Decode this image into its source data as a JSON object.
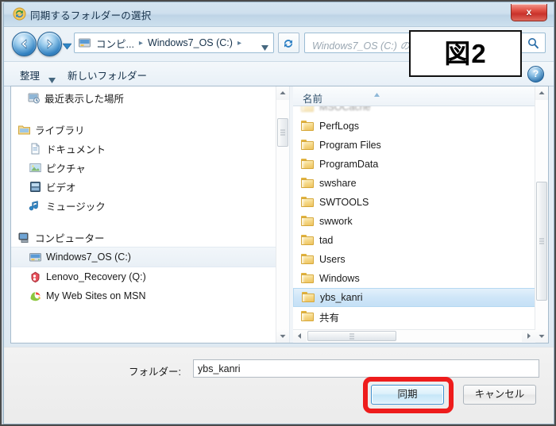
{
  "window": {
    "title": "同期するフォルダーの選択",
    "title_icon": "sync-arrows-icon",
    "close_label": "x"
  },
  "nav": {
    "back_icon": "arrow-left-icon",
    "forward_icon": "arrow-right-icon",
    "history_icon": "chevron-down-icon",
    "address_icon": "drive-icon",
    "address_dropdown_icon": "chevron-down-icon",
    "refresh_icon": "refresh-icon",
    "breadcrumbs": [
      {
        "label": "コンピ..."
      },
      {
        "label": "Windows7_OS (C:)"
      }
    ],
    "crumb_separator": "▸"
  },
  "search": {
    "placeholder": "Windows7_OS (C:) の検索",
    "visible_text": "Wind",
    "icon": "search-icon"
  },
  "command_bar": {
    "organize_label": "整理",
    "organize_caret_icon": "caret-down-icon",
    "new_folder_label": "新しいフォルダー",
    "help_label": "?",
    "help_icon": "help-icon"
  },
  "sidebar": {
    "items": [
      {
        "label": "最近表示した場所",
        "icon": "recent-places-icon",
        "indent": 20,
        "selected": false
      },
      {
        "label": "ライブラリ",
        "icon": "libraries-icon",
        "indent": 8,
        "selected": false
      },
      {
        "label": "ドキュメント",
        "icon": "documents-icon",
        "indent": 22,
        "selected": false
      },
      {
        "label": "ピクチャ",
        "icon": "pictures-icon",
        "indent": 22,
        "selected": false
      },
      {
        "label": "ビデオ",
        "icon": "videos-icon",
        "indent": 22,
        "selected": false
      },
      {
        "label": "ミュージック",
        "icon": "music-icon",
        "indent": 22,
        "selected": false
      },
      {
        "label": "コンピューター",
        "icon": "computer-icon",
        "indent": 8,
        "selected": false
      },
      {
        "label": "Windows7_OS (C:)",
        "icon": "drive-icon",
        "indent": 22,
        "selected": true
      },
      {
        "label": "Lenovo_Recovery (Q:)",
        "icon": "recovery-drive-icon",
        "indent": 22,
        "selected": false
      },
      {
        "label": "My Web Sites on MSN",
        "icon": "msn-icon",
        "indent": 22,
        "selected": false
      }
    ]
  },
  "file_list": {
    "column_header": "名前",
    "sort_icon": "sort-ascending-icon",
    "rows": [
      {
        "name": "MSOCache",
        "icon": "folder-icon",
        "selected": false,
        "clipped": true
      },
      {
        "name": "PerfLogs",
        "icon": "folder-icon",
        "selected": false,
        "clipped": false
      },
      {
        "name": "Program Files",
        "icon": "folder-icon",
        "selected": false,
        "clipped": false
      },
      {
        "name": "ProgramData",
        "icon": "folder-icon",
        "selected": false,
        "clipped": false
      },
      {
        "name": "swshare",
        "icon": "folder-icon",
        "selected": false,
        "clipped": false
      },
      {
        "name": "SWTOOLS",
        "icon": "folder-icon",
        "selected": false,
        "clipped": false
      },
      {
        "name": "swwork",
        "icon": "folder-icon",
        "selected": false,
        "clipped": false
      },
      {
        "name": "tad",
        "icon": "folder-icon",
        "selected": false,
        "clipped": false
      },
      {
        "name": "Users",
        "icon": "folder-icon",
        "selected": false,
        "clipped": false
      },
      {
        "name": "Windows",
        "icon": "folder-icon",
        "selected": false,
        "clipped": false
      },
      {
        "name": "ybs_kanri",
        "icon": "folder-icon",
        "selected": true,
        "clipped": false
      },
      {
        "name": "共有",
        "icon": "folder-icon",
        "selected": false,
        "clipped": false
      }
    ]
  },
  "scrollbars": {
    "up_icon": "scroll-up-icon",
    "down_icon": "scroll-down-icon",
    "left_icon": "scroll-left-icon",
    "right_icon": "scroll-right-icon"
  },
  "footer": {
    "folder_label": "フォルダー:",
    "folder_value": "ybs_kanri",
    "folder_placeholder": "",
    "sync_button": "同期",
    "cancel_button": "キャンセル"
  },
  "annotations": {
    "figure_label": "図2",
    "highlight_color": "#ee1c1c",
    "highlight_target": "sync-button"
  }
}
